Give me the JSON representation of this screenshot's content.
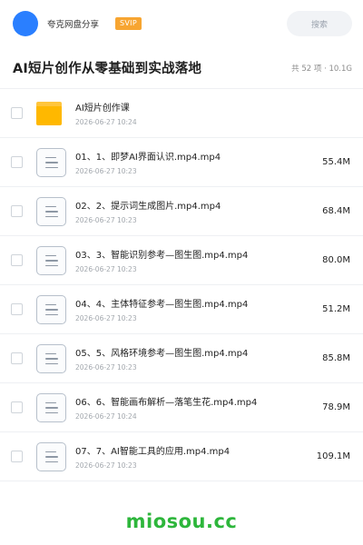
{
  "header": {
    "sharer_name": "夸克网盘分享",
    "badge": "SVIP",
    "search_label": "搜索"
  },
  "title_row": {
    "title": "AI短片创作从零基础到实战落地",
    "summary": "共 52 项 · 10.1G"
  },
  "items": [
    {
      "type": "folder",
      "name": "AI短片创作课",
      "date": "2026-06-27 10:24",
      "size": ""
    },
    {
      "type": "file",
      "name": "01、1、即梦AI界面认识.mp4.mp4",
      "date": "2026-06-27 10:23",
      "size": "55.4M"
    },
    {
      "type": "file",
      "name": "02、2、提示词生成图片.mp4.mp4",
      "date": "2026-06-27 10:23",
      "size": "68.4M"
    },
    {
      "type": "file",
      "name": "03、3、智能识别参考—图生图.mp4.mp4",
      "date": "2026-06-27 10:23",
      "size": "80.0M"
    },
    {
      "type": "file",
      "name": "04、4、主体特征参考—图生图.mp4.mp4",
      "date": "2026-06-27 10:23",
      "size": "51.2M"
    },
    {
      "type": "file",
      "name": "05、5、风格环境参考—图生图.mp4.mp4",
      "date": "2026-06-27 10:23",
      "size": "85.8M"
    },
    {
      "type": "file",
      "name": "06、6、智能画布解析—落笔生花.mp4.mp4",
      "date": "2026-06-27 10:24",
      "size": "78.9M"
    },
    {
      "type": "file",
      "name": "07、7、AI智能工具的应用.mp4.mp4",
      "date": "2026-06-27 10:23",
      "size": "109.1M"
    }
  ],
  "footer": {
    "brand": "miosou.cc"
  },
  "colors": {
    "accent": "#2a7fff",
    "badge": "#f7a531",
    "folder": "#ffb800",
    "brand": "#2db63b"
  }
}
